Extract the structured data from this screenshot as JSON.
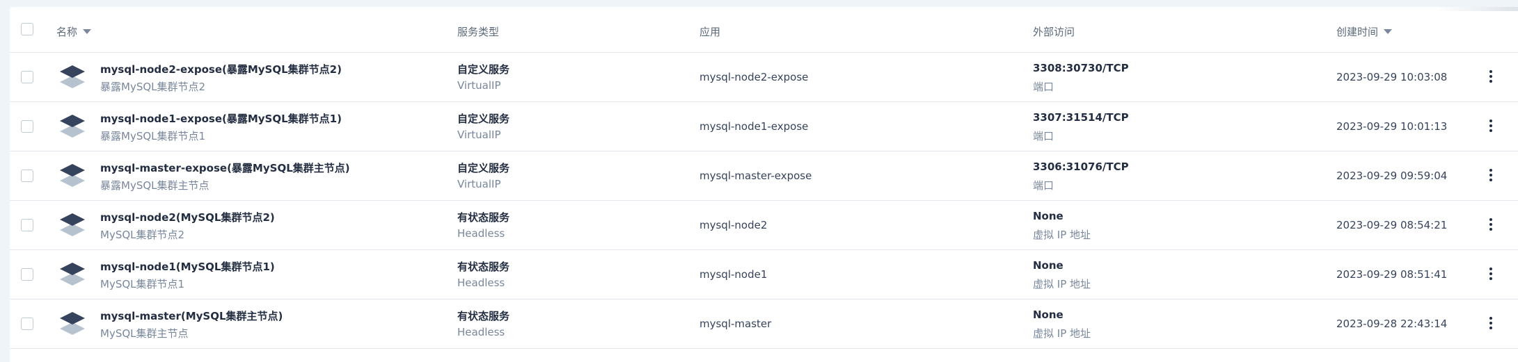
{
  "table": {
    "headers": {
      "name": "名称",
      "service_type": "服务类型",
      "app": "应用",
      "external_access": "外部访问",
      "created": "创建时间"
    },
    "rows": [
      {
        "name": "mysql-node2-expose(暴露MySQL集群节点2)",
        "desc": "暴露MySQL集群节点2",
        "type": "自定义服务",
        "subtype": "VirtualIP",
        "app": "mysql-node2-expose",
        "access": "3308:30730/TCP",
        "access_sub": "端口",
        "time": "2023-09-29 10:03:08"
      },
      {
        "name": "mysql-node1-expose(暴露MySQL集群节点1)",
        "desc": "暴露MySQL集群节点1",
        "type": "自定义服务",
        "subtype": "VirtualIP",
        "app": "mysql-node1-expose",
        "access": "3307:31514/TCP",
        "access_sub": "端口",
        "time": "2023-09-29 10:01:13"
      },
      {
        "name": "mysql-master-expose(暴露MySQL集群主节点)",
        "desc": "暴露MySQL集群主节点",
        "type": "自定义服务",
        "subtype": "VirtualIP",
        "app": "mysql-master-expose",
        "access": "3306:31076/TCP",
        "access_sub": "端口",
        "time": "2023-09-29 09:59:04"
      },
      {
        "name": "mysql-node2(MySQL集群节点2)",
        "desc": "MySQL集群节点2",
        "type": "有状态服务",
        "subtype": "Headless",
        "app": "mysql-node2",
        "access": "None",
        "access_sub": "虚拟 IP 地址",
        "time": "2023-09-29 08:54:21"
      },
      {
        "name": "mysql-node1(MySQL集群节点1)",
        "desc": "MySQL集群节点1",
        "type": "有状态服务",
        "subtype": "Headless",
        "app": "mysql-node1",
        "access": "None",
        "access_sub": "虚拟 IP 地址",
        "time": "2023-09-29 08:51:41"
      },
      {
        "name": "mysql-master(MySQL集群主节点)",
        "desc": "MySQL集群主节点",
        "type": "有状态服务",
        "subtype": "Headless",
        "app": "mysql-master",
        "access": "None",
        "access_sub": "虚拟 IP 地址",
        "time": "2023-09-28 22:43:14"
      }
    ]
  },
  "icons": {
    "service": "service-stack-icon",
    "sort": "sort-down-icon",
    "more": "more-vertical-icon"
  },
  "colors": {
    "icon_dark": "#36435c",
    "icon_light": "#b7c2cf",
    "text_primary": "#242e42",
    "text_secondary": "#79879c",
    "border": "#e3e9ef",
    "page_bg": "#eff4f9"
  }
}
